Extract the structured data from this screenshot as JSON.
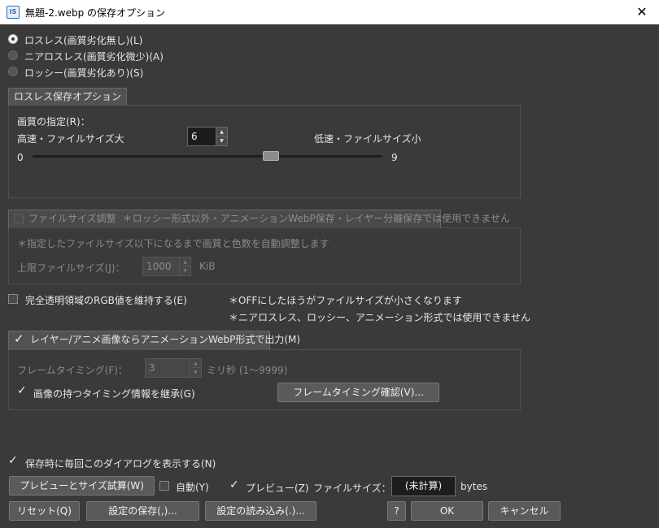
{
  "window": {
    "title": "無題-2.webp の保存オプション",
    "app_icon": "IS",
    "close_glyph": "✕"
  },
  "compression_modes": [
    {
      "label": "ロスレス(画質劣化無し)(L)",
      "selected": true
    },
    {
      "label": "ニアロスレス(画質劣化微少)(A)",
      "selected": false
    },
    {
      "label": "ロッシー(画質劣化あり)(S)",
      "selected": false
    }
  ],
  "lossless": {
    "group_label": "ロスレス保存オプション",
    "quality_label": "画質の指定(R)：",
    "fast_label": "高速・ファイルサイズ大",
    "slow_label": "低速・ファイルサイズ小",
    "quality_value": "6",
    "slider_min": "0",
    "slider_max": "9",
    "slider_level": 6
  },
  "filesize_adjust": {
    "checkbox_label": "ファイルサイズ調整",
    "note": "＊ロッシー形式以外・アニメーションWebP保存・レイヤー分離保存では使用できません",
    "description": "＊指定したファイルサイズ以下になるまで画質と色数を自動調整します",
    "limit_label": "上限ファイルサイズ(J)：",
    "limit_value": "1000",
    "limit_unit": "KiB"
  },
  "keep_rgb": {
    "label": "完全透明領域のRGB値を維持する(E)",
    "checked": false,
    "note1": "＊OFFにしたほうがファイルサイズが小さくなります",
    "note2": "＊ニアロスレス、ロッシー、アニメーション形式では使用できません"
  },
  "animation": {
    "checkbox_label": "レイヤー/アニメ画像ならアニメーションWebP形式で出力(M)",
    "checked": true,
    "timing_label": "フレームタイミング(F)：",
    "timing_value": "3",
    "timing_unit": "ミリ秒 (1〜9999)",
    "inherit_label": "画像の持つタイミング情報を継承(G)",
    "inherit_checked": true,
    "confirm_button": "フレームタイミング確認(V)..."
  },
  "show_dialog": {
    "label": "保存時に毎回このダイアログを表示する(N)",
    "checked": true
  },
  "preview_row": {
    "preview_button": "プレビューとサイズ試算(W)",
    "auto_label": "自動(Y)",
    "auto_checked": false,
    "preview_label": "プレビュー(Z)",
    "preview_checked": true,
    "filesize_label": "ファイルサイズ：",
    "filesize_value": "(未計算)",
    "filesize_unit": "bytes"
  },
  "buttons": {
    "reset": "リセット(Q)",
    "save_settings": "設定の保存(,)...",
    "load_settings": "設定の読み込み(.)...",
    "help": "?",
    "ok": "OK",
    "cancel": "キャンセル"
  },
  "icons": {
    "check": "✓",
    "spin_up": "▲",
    "spin_down": "▼"
  },
  "colors": {
    "background": "#3a3a3a",
    "text": "#e6e6e6",
    "disabled_text": "#8a8a8a",
    "field": "#1c1c1c"
  }
}
